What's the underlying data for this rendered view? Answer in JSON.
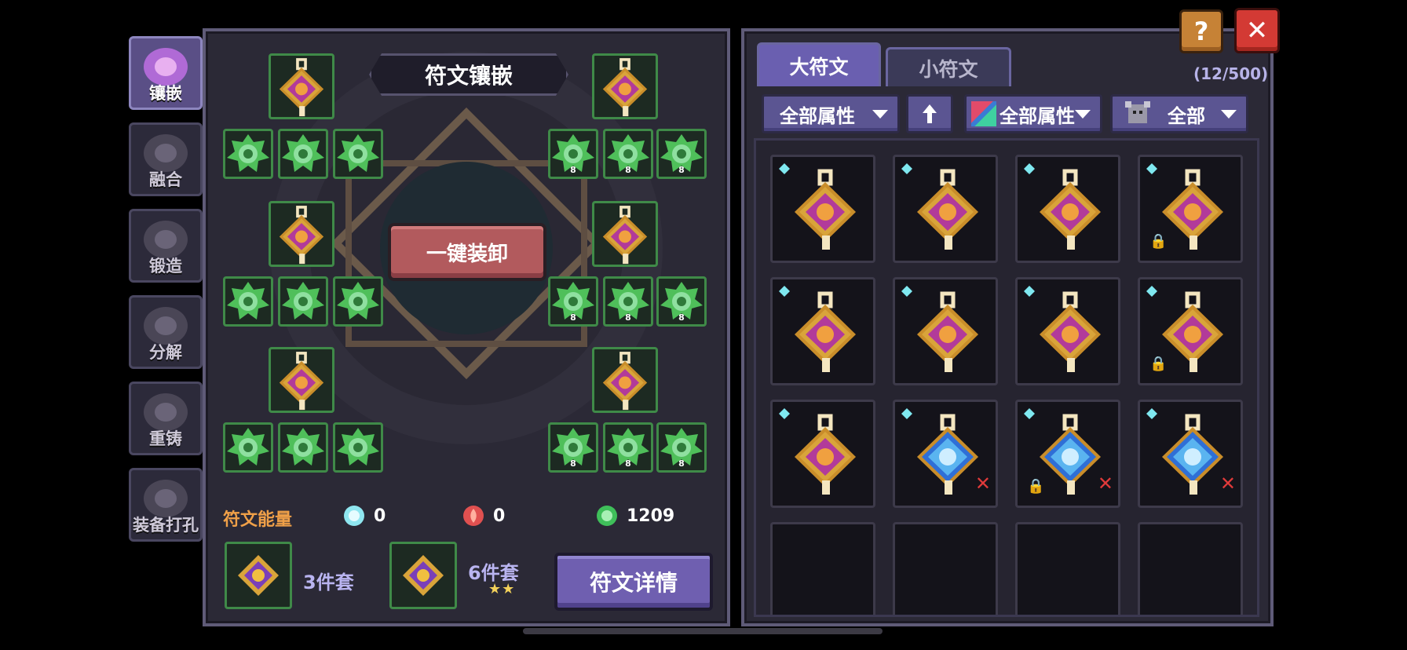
{
  "side_tabs": [
    {
      "label": "镶嵌",
      "icon": "socket-icon",
      "active": true
    },
    {
      "label": "融合",
      "icon": "fusion-icon",
      "active": false
    },
    {
      "label": "锻造",
      "icon": "forge-icon",
      "active": false
    },
    {
      "label": "分解",
      "icon": "decompose-icon",
      "active": false
    },
    {
      "label": "重铸",
      "icon": "recast-icon",
      "active": false
    },
    {
      "label": "装备打孔",
      "icon": "drill-icon",
      "active": false
    }
  ],
  "socket": {
    "title": "符文镶嵌",
    "unequip_all": "一键装卸",
    "small_slot_levels": {
      "right_row1": [
        "8",
        "8",
        "8"
      ],
      "right_row2": [
        "8",
        "8",
        "8"
      ],
      "right_row3": [
        "8",
        "8",
        "8"
      ]
    }
  },
  "energy": {
    "label": "符文能量",
    "items": [
      {
        "icon": "blue-crystal-icon",
        "value": "0"
      },
      {
        "icon": "red-flame-icon",
        "value": "0"
      },
      {
        "icon": "green-orb-icon",
        "value": "1209"
      }
    ]
  },
  "sets": [
    {
      "label": "3件套",
      "stars": ""
    },
    {
      "label": "6件套",
      "stars": "★★"
    }
  ],
  "detail_button": "符文详情",
  "right_tabs": {
    "big": "大符文",
    "small": "小符文"
  },
  "count": "(12/500)",
  "filters": {
    "attr1": "全部属性",
    "sort_icon": "arrow-up-icon",
    "attr2": "全部属性",
    "type": "全部"
  },
  "runes": [
    {
      "color": "gold",
      "lock": false,
      "x": false
    },
    {
      "color": "gold",
      "lock": false,
      "x": false
    },
    {
      "color": "gold",
      "lock": false,
      "x": false
    },
    {
      "color": "gold",
      "lock": true,
      "x": false
    },
    {
      "color": "gold",
      "lock": false,
      "x": false
    },
    {
      "color": "gold",
      "lock": false,
      "x": false
    },
    {
      "color": "gold",
      "lock": false,
      "x": false
    },
    {
      "color": "gold",
      "lock": true,
      "x": false
    },
    {
      "color": "gold",
      "lock": false,
      "x": false
    },
    {
      "color": "blue",
      "lock": false,
      "x": true
    },
    {
      "color": "blue",
      "lock": true,
      "x": true
    },
    {
      "color": "blue",
      "lock": false,
      "x": true
    }
  ],
  "glyphs": {
    "help": "?",
    "close": "✕",
    "lock": "🔒",
    "remove": "✕"
  },
  "colors": {
    "accent": "#6a5fb0",
    "energy_label": "#f0a048",
    "slot_border": "#3f8a48",
    "unequip": "#b25a5d"
  }
}
